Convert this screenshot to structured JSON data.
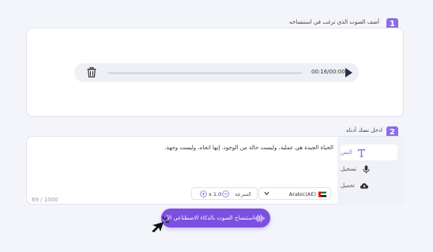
{
  "step1": {
    "number": "1",
    "title": "أضف الصوت الذي ترغب في استنساخه"
  },
  "player": {
    "time": "00:16/00:00",
    "progress": 0
  },
  "step2": {
    "number": "2",
    "title": "ادخل نصك أدناه"
  },
  "sidebar": {
    "items": [
      {
        "label": "النص",
        "icon": "text-icon",
        "active": true
      },
      {
        "label": "تسجيل",
        "icon": "microphone-icon",
        "active": false
      },
      {
        "label": "تحميل",
        "icon": "cloud-upload-icon",
        "active": false
      }
    ]
  },
  "editor": {
    "text": "الحياة الجيدة هي عملية، وليست حالة من الوجود. إنها اتجاه، وليست وجهة.",
    "counter": "69 / 1000"
  },
  "language": {
    "selected": "Arabic(AE)",
    "flag": "uae-flag-icon"
  },
  "speed": {
    "label": "السرعة",
    "value": "x 1.0"
  },
  "cta": {
    "label": "استنساخ الصوت بالذكاء الاصطناعي الآن"
  },
  "colors": {
    "accent": "#8b6fe0",
    "button": "#7b4fe0"
  }
}
